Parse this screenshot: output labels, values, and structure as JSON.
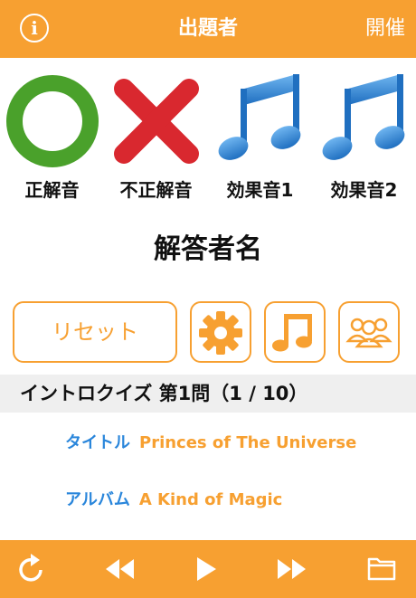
{
  "header": {
    "info_symbol": "i",
    "title": "出題者",
    "host_label": "開催"
  },
  "sounds": [
    {
      "label": "正解音",
      "icon": "circle-icon",
      "color": "#4aa12b"
    },
    {
      "label": "不正解音",
      "icon": "cross-icon",
      "color": "#d9282f"
    },
    {
      "label": "効果音1",
      "icon": "music-note-icon",
      "color": "#2a86db"
    },
    {
      "label": "効果音2",
      "icon": "music-note-icon",
      "color": "#2a86db"
    }
  ],
  "answerer_name": "解答者名",
  "controls": {
    "reset_label": "リセット",
    "settings_icon": "gear-icon",
    "music_icon": "music-note-icon",
    "players_icon": "group-icon"
  },
  "question_bar": {
    "text": "イントロクイズ 第1問（1 / 10）"
  },
  "track": {
    "title_key": "タイトル",
    "title_value": "Princes of The Universe",
    "album_key": "アルバム",
    "album_value": "A Kind of Magic"
  },
  "bottom_toolbar": {
    "icons": [
      "refresh-icon",
      "rewind-icon",
      "play-icon",
      "fast-forward-icon",
      "folder-icon"
    ]
  },
  "colors": {
    "accent": "#f7a031",
    "link_blue": "#2a86db",
    "correct_green": "#4aa12b",
    "wrong_red": "#d9282f"
  }
}
